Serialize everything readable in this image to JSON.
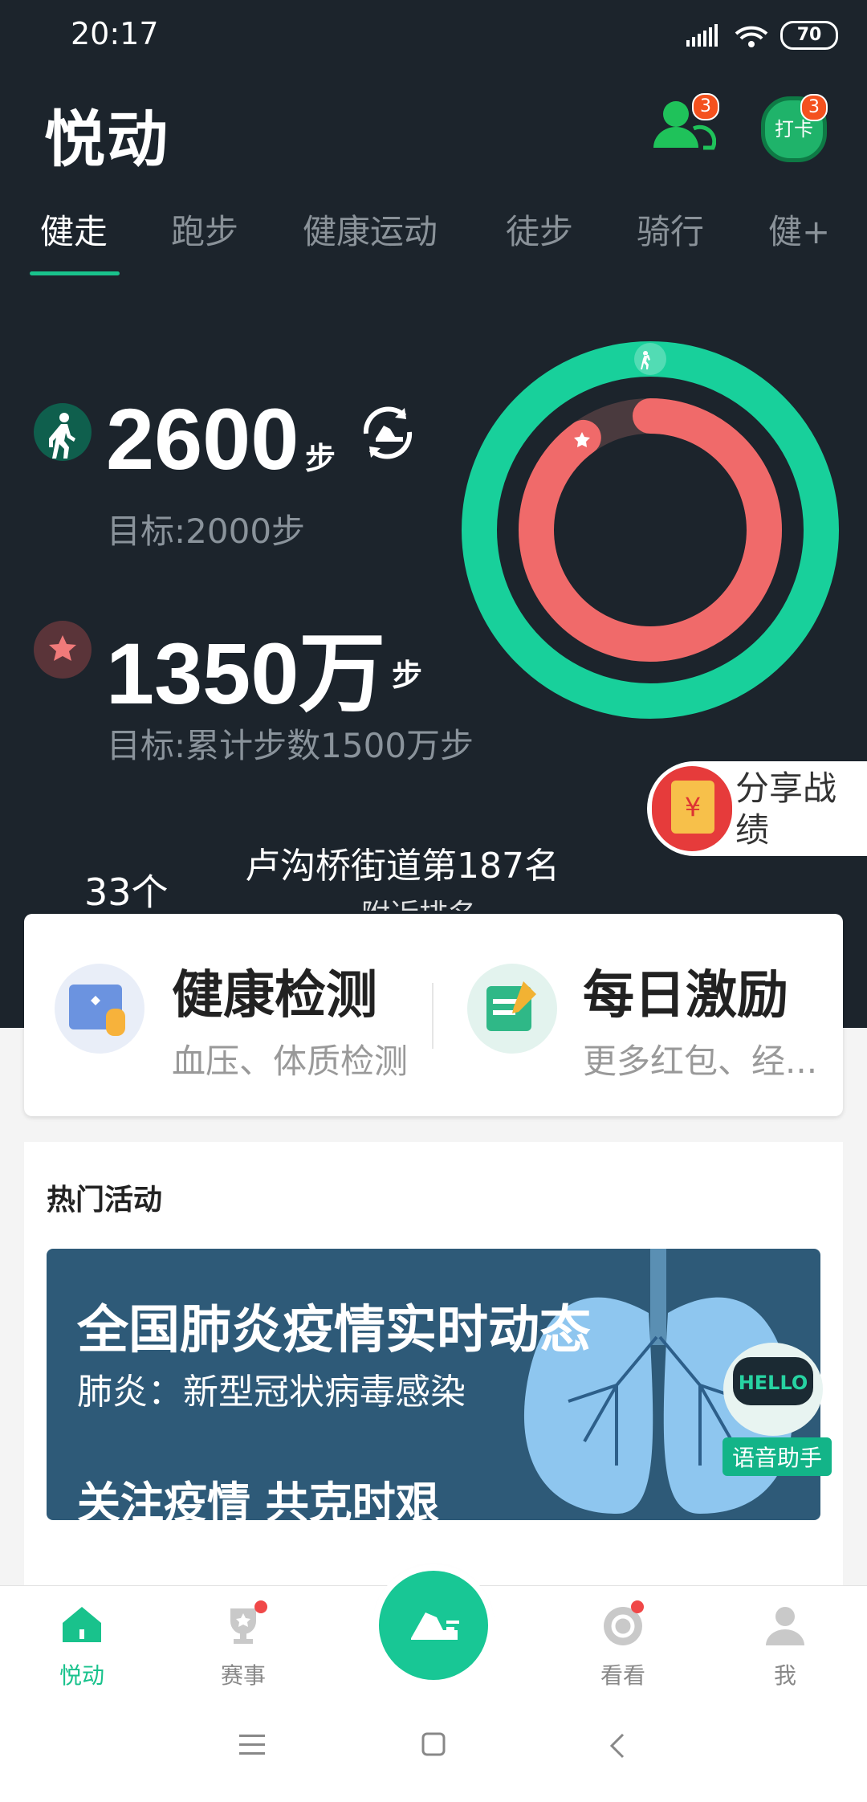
{
  "status_bar": {
    "time": "20:17",
    "battery": "70"
  },
  "header": {
    "title": "悦动",
    "friends_badge": "3",
    "checkin_label": "打卡",
    "checkin_badge": "3"
  },
  "tabs": [
    {
      "label": "健走",
      "active": true
    },
    {
      "label": "跑步",
      "active": false
    },
    {
      "label": "健康运动",
      "active": false
    },
    {
      "label": "徒步",
      "active": false
    },
    {
      "label": "骑行",
      "active": false
    },
    {
      "label": "健+",
      "active": false
    }
  ],
  "stats": {
    "steps": {
      "value": "2600",
      "unit": "步",
      "goal": "目标:2000步"
    },
    "total": {
      "value": "1350万",
      "unit": "步",
      "goal": "目标:累计步数1500万步"
    }
  },
  "progress": {
    "daily_fraction": 1.0,
    "cumulative_fraction": 0.9
  },
  "share": {
    "label": "分享战绩"
  },
  "partial": {
    "count": "33个",
    "rank_line": "卢沟桥街道第187名",
    "rank_sub": "附近排名"
  },
  "cards": [
    {
      "title": "健康检测",
      "subtitle": "血压、体质检测"
    },
    {
      "title": "每日激励",
      "subtitle": "更多红包、经..."
    }
  ],
  "hot": {
    "section_title": "热门活动",
    "banner_title": "全国肺炎疫情实时动态",
    "banner_subtitle": "肺炎：新型冠状病毒感染",
    "banner_footer": "关注疫情 共克时艰",
    "voice_assistant": "语音助手",
    "hello": "HELLO"
  },
  "bottom_nav": [
    {
      "label": "悦动",
      "icon": "home-icon",
      "active": true
    },
    {
      "label": "赛事",
      "icon": "trophy-icon",
      "active": false
    },
    {
      "label": "看看",
      "icon": "discover-icon",
      "active": false
    },
    {
      "label": "我",
      "icon": "profile-icon",
      "active": false
    }
  ],
  "colors": {
    "accent": "#19c28c",
    "background_dark": "#1c242c",
    "inner_ring": "#f06a6a",
    "badge": "#f4511e"
  }
}
